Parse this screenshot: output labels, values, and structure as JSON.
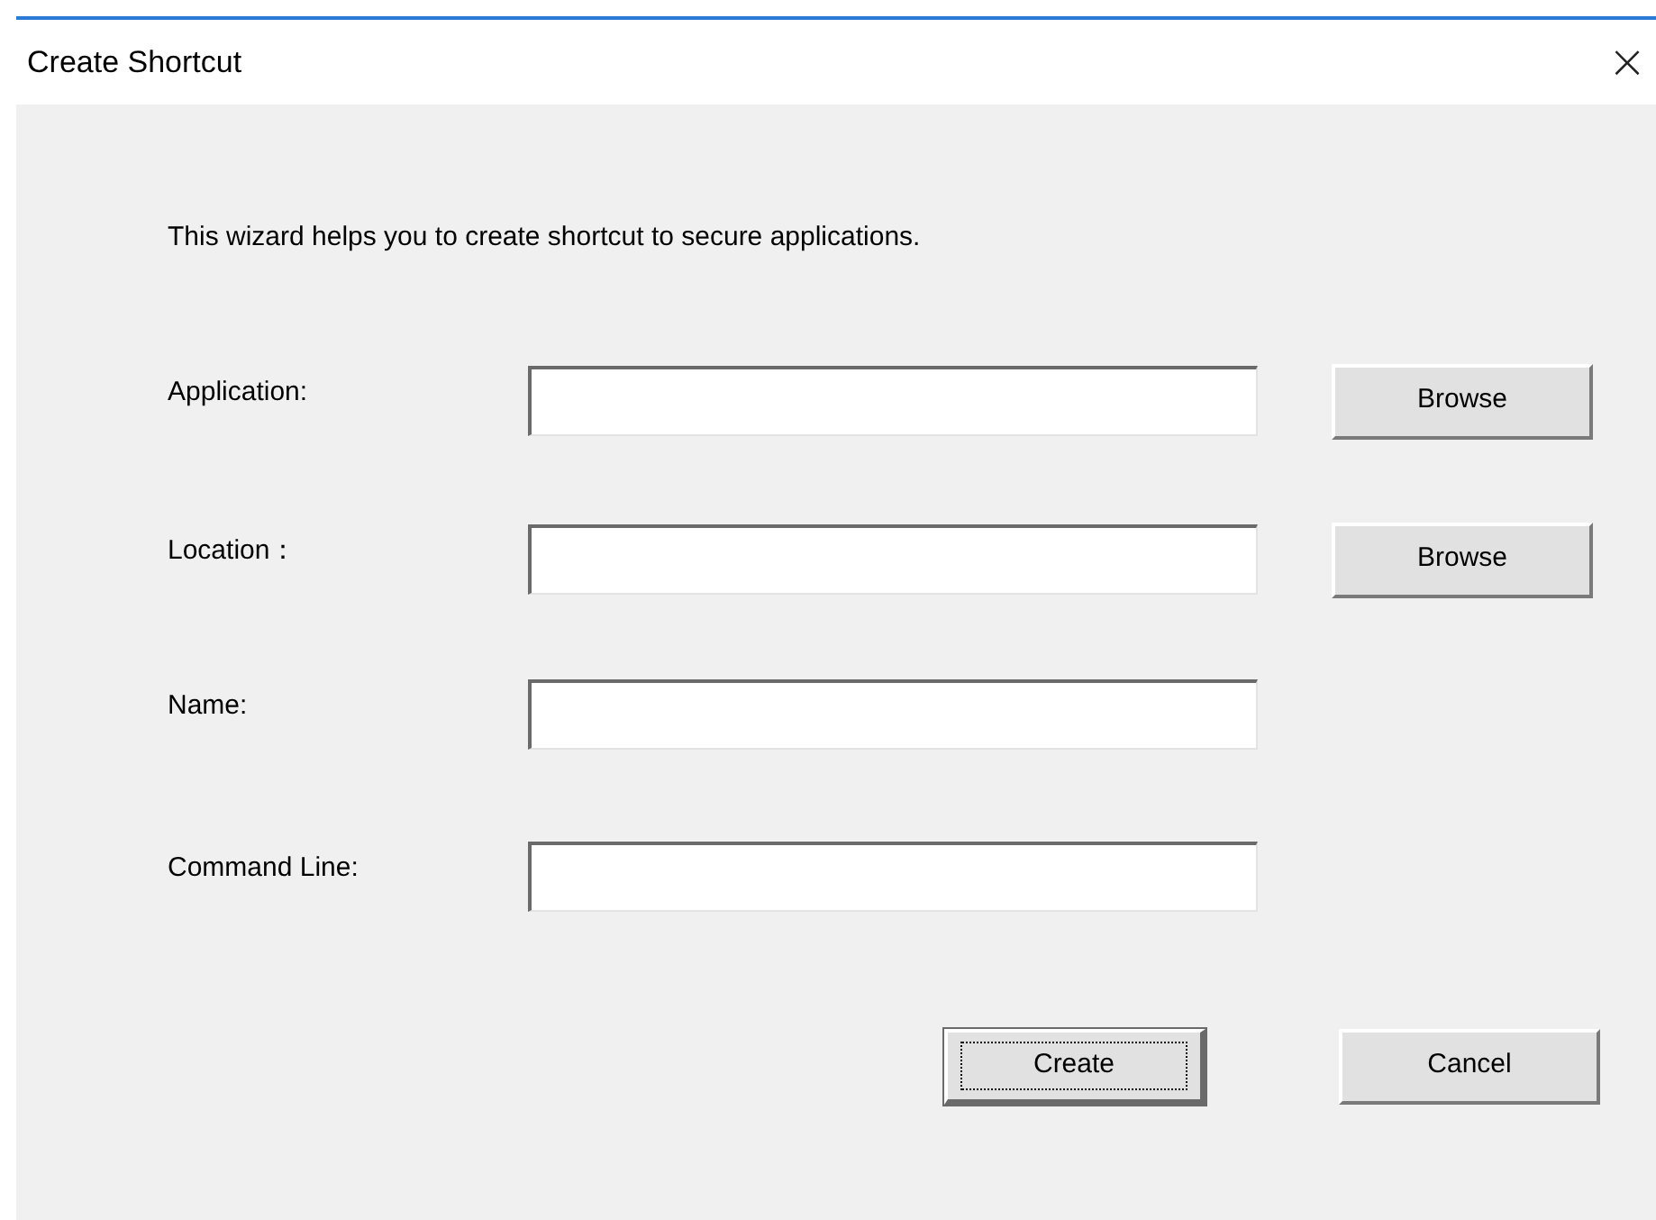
{
  "window": {
    "title": "Create Shortcut",
    "close": "×"
  },
  "intro": "This wizard helps you to create shortcut to secure applications.",
  "fields": [
    {
      "label": "Application:",
      "button": "Browse"
    },
    {
      "label": "Location：",
      "button": "Browse"
    },
    {
      "label": "Name:"
    },
    {
      "label": "Command Line:"
    }
  ],
  "buttons": [
    {
      "label": "Create",
      "focused": true
    },
    {
      "label": "Cancel",
      "focused": false
    }
  ]
}
